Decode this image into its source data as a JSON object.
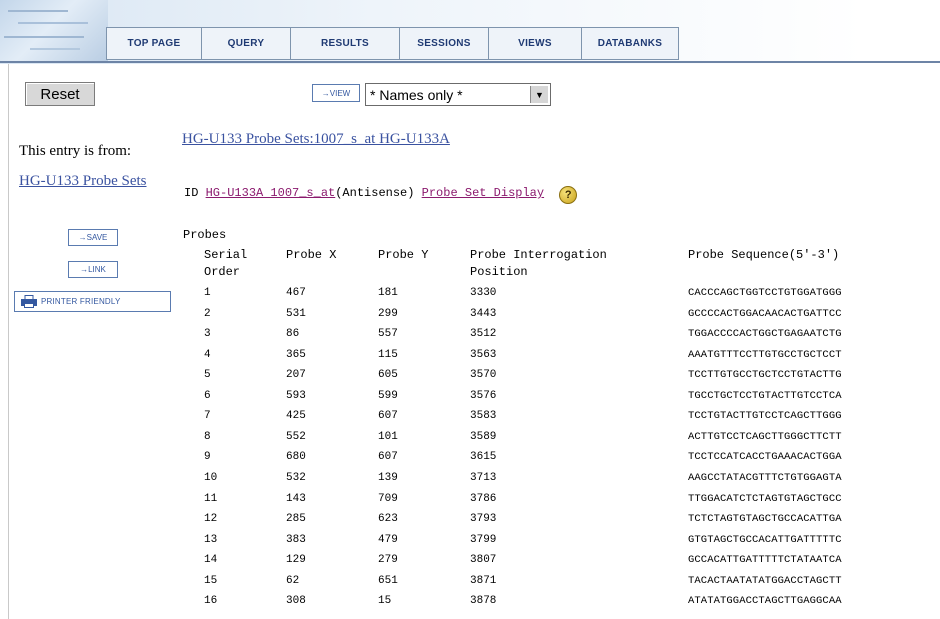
{
  "nav": {
    "tabs": [
      "TOP PAGE",
      "QUERY",
      "RESULTS",
      "SESSIONS",
      "VIEWS",
      "DATABANKS"
    ]
  },
  "toolbar": {
    "reset_label": "Reset",
    "view_button_label": "→VIEW",
    "view_select_value": "* Names only *"
  },
  "sidebar": {
    "entry_from_label": "This entry is from:",
    "source_link": "HG-U133 Probe Sets",
    "save_label": "→SAVE",
    "link_label": "→LINK",
    "printer_label": "PRINTER FRIENDLY"
  },
  "entry": {
    "title_link": "HG-U133 Probe Sets:1007_s_at HG-U133A",
    "id_prefix": "ID",
    "id_link": "HG-U133A 1007_s_at",
    "strand": "(Antisense)",
    "display_link": "Probe Set Display",
    "help_symbol": "?"
  },
  "probes": {
    "label": "Probes",
    "headers": {
      "serial_line1": "Serial",
      "serial_line2": "Order",
      "probe_x": "Probe X",
      "probe_y": "Probe Y",
      "interrogation_line1": "Probe Interrogation",
      "interrogation_line2": "Position",
      "sequence": "Probe Sequence(5'-3')"
    },
    "rows": [
      {
        "order": "1",
        "x": "467",
        "y": "181",
        "pos": "3330",
        "seq": "CACCCAGCTGGTCCTGTGGATGGG"
      },
      {
        "order": "2",
        "x": "531",
        "y": "299",
        "pos": "3443",
        "seq": "GCCCCACTGGACAACACTGATTCC"
      },
      {
        "order": "3",
        "x": "86",
        "y": "557",
        "pos": "3512",
        "seq": "TGGACCCCACTGGCTGAGAATCTG"
      },
      {
        "order": "4",
        "x": "365",
        "y": "115",
        "pos": "3563",
        "seq": "AAATGTTTCCTTGTGCCTGCTCCT"
      },
      {
        "order": "5",
        "x": "207",
        "y": "605",
        "pos": "3570",
        "seq": "TCCTTGTGCCTGCTCCTGTACTTG"
      },
      {
        "order": "6",
        "x": "593",
        "y": "599",
        "pos": "3576",
        "seq": "TGCCTGCTCCTGTACTTGTCCTCA"
      },
      {
        "order": "7",
        "x": "425",
        "y": "607",
        "pos": "3583",
        "seq": "TCCTGTACTTGTCCTCAGCTTGGG"
      },
      {
        "order": "8",
        "x": "552",
        "y": "101",
        "pos": "3589",
        "seq": "ACTTGTCCTCAGCTTGGGCTTCTT"
      },
      {
        "order": "9",
        "x": "680",
        "y": "607",
        "pos": "3615",
        "seq": "TCCTCCATCACCTGAAACACTGGA"
      },
      {
        "order": "10",
        "x": "532",
        "y": "139",
        "pos": "3713",
        "seq": "AAGCCTATACGTTTCTGTGGAGTA"
      },
      {
        "order": "11",
        "x": "143",
        "y": "709",
        "pos": "3786",
        "seq": "TTGGACATCTCTAGTGTAGCTGCC"
      },
      {
        "order": "12",
        "x": "285",
        "y": "623",
        "pos": "3793",
        "seq": "TCTCTAGTGTAGCTGCCACATTGA"
      },
      {
        "order": "13",
        "x": "383",
        "y": "479",
        "pos": "3799",
        "seq": "GTGTAGCTGCCACATTGATTTTTC"
      },
      {
        "order": "14",
        "x": "129",
        "y": "279",
        "pos": "3807",
        "seq": "GCCACATTGATTTTTCTATAATCA"
      },
      {
        "order": "15",
        "x": "62",
        "y": "651",
        "pos": "3871",
        "seq": "TACACTAATATATGGACCTAGCTT"
      },
      {
        "order": "16",
        "x": "308",
        "y": "15",
        "pos": "3878",
        "seq": "ATATATGGACCTAGCTTGAGGCAA"
      }
    ]
  }
}
